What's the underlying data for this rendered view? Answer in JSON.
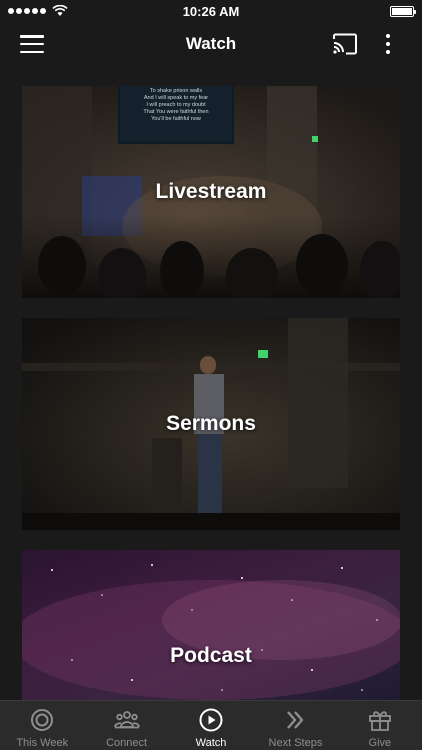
{
  "status_bar": {
    "time": "10:26 AM"
  },
  "nav": {
    "title": "Watch"
  },
  "cards": [
    {
      "label": "Livestream"
    },
    {
      "label": "Sermons"
    },
    {
      "label": "Podcast"
    }
  ],
  "livestream_screen_lines": [
    "To shake prison walls",
    "And I will speak to my fear",
    "I will preach to my doubt",
    "That You were faithful then",
    "You'll be faithful now"
  ],
  "tabs": [
    {
      "label": "This Week",
      "icon": "target-icon",
      "active": false
    },
    {
      "label": "Connect",
      "icon": "people-icon",
      "active": false
    },
    {
      "label": "Watch",
      "icon": "play-circle-icon",
      "active": true
    },
    {
      "label": "Next Steps",
      "icon": "double-chevron-icon",
      "active": false
    },
    {
      "label": "Give",
      "icon": "gift-icon",
      "active": false
    }
  ],
  "colors": {
    "active_tab": "#ffffff",
    "inactive_tab": "#8e8e8e",
    "tab_bar_bg": "#2b2b2b",
    "background": "#1a1a1a"
  }
}
